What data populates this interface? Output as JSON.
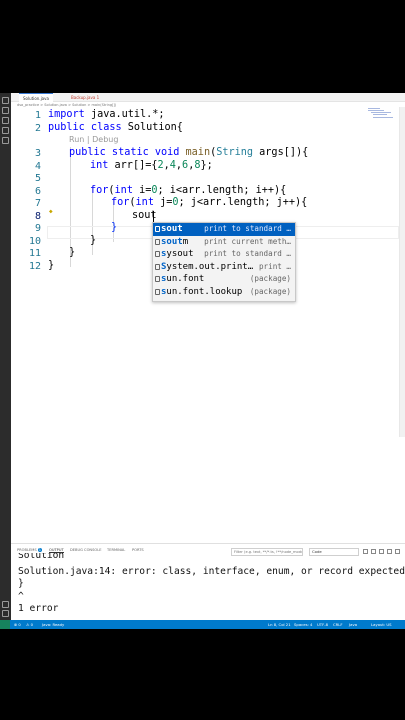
{
  "tabs": [
    {
      "label": "Solution.java"
    },
    {
      "label": "Backup.java 1"
    }
  ],
  "breadcrumb": "dsa_practice > Solution.java > Solution > main(String[])",
  "code_lens": "Run | Debug",
  "lines": [
    {
      "n": "1"
    },
    {
      "n": "2"
    },
    {
      "n": "3"
    },
    {
      "n": "4"
    },
    {
      "n": "5"
    },
    {
      "n": "6"
    },
    {
      "n": "7"
    },
    {
      "n": "8"
    },
    {
      "n": "9"
    },
    {
      "n": "10"
    },
    {
      "n": "11"
    },
    {
      "n": "12"
    }
  ],
  "code": {
    "l1_kw": "import",
    "l1_rest": " java.util.*;",
    "l2_kw": "public class",
    "l2_rest": " Solution{",
    "l3_kw": "public static void",
    "l3_fn": " main",
    "l3_p1": "(",
    "l3_ty": "String",
    "l3_rest": " args[]){",
    "l4_kw": "int",
    "l4_a": " arr[]={",
    "l4_n1": "2",
    "l4_c1": ",",
    "l4_n2": "4",
    "l4_c2": ",",
    "l4_n3": "6",
    "l4_c3": ",",
    "l4_n4": "8",
    "l4_end": "};",
    "l6_kw": "for",
    "l6_p": "(",
    "l6_kw2": "int",
    "l6_a": " i=",
    "l6_n": "0",
    "l6_rest": "; i<arr.length; i++){",
    "l7_kw": "for",
    "l7_p": "(",
    "l7_kw2": "int",
    "l7_a": " j=",
    "l7_n": "0",
    "l7_rest": "; j<arr.length; j++){",
    "l8": "sout",
    "l9": "}",
    "l10": "}",
    "l11": "}",
    "l12": "}"
  },
  "suggestions": [
    {
      "match": "sout",
      "rest": "",
      "detail": "print to standard …",
      "selected": true
    },
    {
      "match": "sout",
      "rest": "m",
      "detail": "print current meth…"
    },
    {
      "match": "s",
      "rest": "ysout",
      "detail": "print to standard …"
    },
    {
      "match": "S",
      "rest": "ystem.out.print…",
      "detail": "print …"
    },
    {
      "match": "s",
      "rest": "un.font",
      "detail": "(package)"
    },
    {
      "match": "s",
      "rest": "un.font.lookup",
      "detail": "(package)"
    }
  ],
  "panel": {
    "tabs": [
      "PROBLEMS",
      "OUTPUT",
      "DEBUG CONSOLE",
      "TERMINAL",
      "PORTS"
    ],
    "problems_count": "1",
    "filter_placeholder": "Filter (e.g. text, **/*.ts, !**/node_modules/**)",
    "channel": "Code",
    "output_lines": [
      "Solution",
      "Solution.java:14: error: class, interface, enum, or record expected",
      "}",
      "^",
      "1 error"
    ]
  },
  "status": {
    "errors": "0",
    "warnings": "0",
    "java": "Java: Ready",
    "position": "Ln 8, Col 21",
    "spaces": "Spaces: 4",
    "encoding": "UTF-8",
    "eol": "CRLF",
    "language": "Java",
    "extra": "Layout: US"
  },
  "colors": {
    "accent": "#007acc",
    "selection": "#0060c0",
    "keyword": "#0000ff",
    "type": "#267f99",
    "number": "#098658",
    "line_number": "#237893"
  }
}
